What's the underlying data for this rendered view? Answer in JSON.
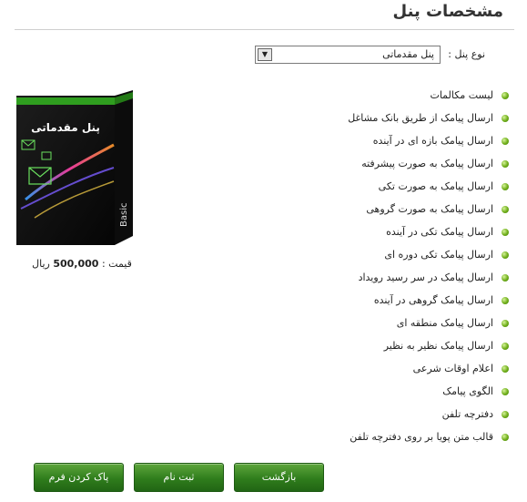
{
  "page": {
    "title": "مشخصات پنل"
  },
  "panel_type": {
    "label": "نوع پنل :",
    "selected": "پنل مقدماتی"
  },
  "features": [
    "لیست مکالمات",
    "ارسال پیامک از طریق بانک مشاغل",
    "ارسال پیامک بازه ای در آینده",
    "ارسال پیامک به صورت پیشرفته",
    "ارسال پیامک به صورت تکی",
    "ارسال پیامک به صورت گروهی",
    "ارسال پیامک تکی در آینده",
    "ارسال پیامک تکی دوره ای",
    "ارسال پیامک در سر رسید رویداد",
    "ارسال پیامک گروهی در آینده",
    "ارسال پیامک منطقه ای",
    "ارسال پیامک نظیر به نظیر",
    "اعلام اوقات شرعی",
    "الگوی پیامک",
    "دفترچه تلفن",
    "قالب متن پویا بر روی دفترچه تلفن"
  ],
  "product": {
    "box_title": "پنل مقدماتی",
    "box_tag": "Basic",
    "price_label": "قیمت :",
    "price_value": "500,000",
    "price_unit": "ریال"
  },
  "buttons": {
    "back": "بازگشت",
    "register": "ثبت نام",
    "clear": "پاک کردن فرم"
  },
  "colors": {
    "button_green": "#2f7d1c",
    "bullet_green": "#6fae1a"
  }
}
